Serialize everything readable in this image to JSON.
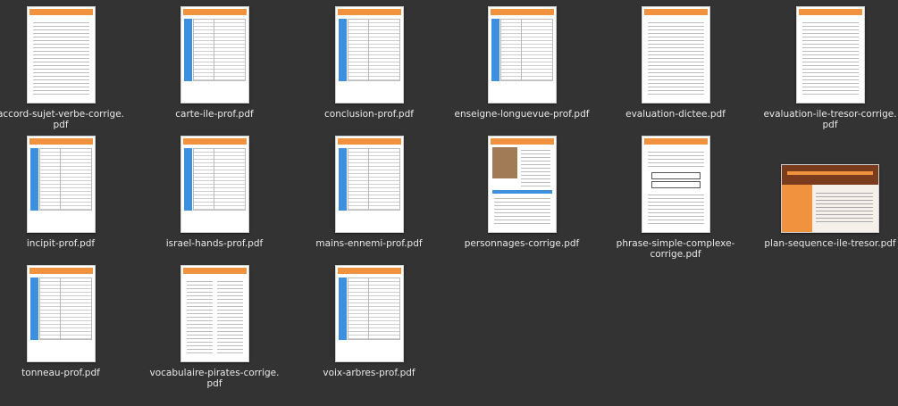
{
  "files": [
    {
      "name": "accord-sujet-verbe-corrige.\npdf",
      "style": "lines"
    },
    {
      "name": "carte-ile-prof.pdf",
      "style": "table"
    },
    {
      "name": "conclusion-prof.pdf",
      "style": "table"
    },
    {
      "name": "enseigne-longuevue-prof.pdf",
      "style": "table"
    },
    {
      "name": "evaluation-dictee.pdf",
      "style": "lines"
    },
    {
      "name": "evaluation-ile-tresor-corrige.\npdf",
      "style": "lines"
    },
    {
      "name": "incipit-prof.pdf",
      "style": "table"
    },
    {
      "name": "israel-hands-prof.pdf",
      "style": "table"
    },
    {
      "name": "mains-ennemi-prof.pdf",
      "style": "table"
    },
    {
      "name": "personnages-corrige.pdf",
      "style": "photo"
    },
    {
      "name": "phrase-simple-complexe-\ncorrige.pdf",
      "style": "boxes"
    },
    {
      "name": "plan-sequence-ile-tresor.pdf",
      "style": "landscape"
    },
    {
      "name": "tonneau-prof.pdf",
      "style": "table"
    },
    {
      "name": "vocabulaire-pirates-corrige.\npdf",
      "style": "twocol"
    },
    {
      "name": "voix-arbres-prof.pdf",
      "style": "table"
    }
  ],
  "colors": {
    "background": "#333333",
    "accent": "#f1923f",
    "blue": "#3d8fe0",
    "label": "#e8e8e8"
  },
  "icons": {
    "file_thumbnail": "pdf-thumbnail-icon"
  }
}
